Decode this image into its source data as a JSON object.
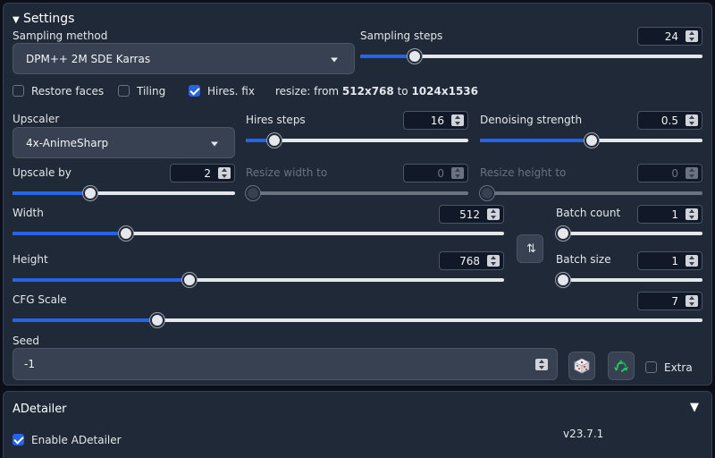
{
  "settings": {
    "title": "Settings",
    "sampling_method_label": "Sampling method",
    "sampling_method_value": "DPM++ 2M SDE Karras",
    "sampling_steps_label": "Sampling steps",
    "sampling_steps_value": "24",
    "sampling_steps_frac": 0.16,
    "restore_faces_label": "Restore faces",
    "tiling_label": "Tiling",
    "hires_fix_label": "Hires. fix",
    "resize_prefix": "resize: from ",
    "resize_from": "512x768",
    "resize_mid": " to ",
    "resize_to": "1024x1536",
    "upscaler_label": "Upscaler",
    "upscaler_value": "4x-AnimeSharp",
    "hires_steps_label": "Hires steps",
    "hires_steps_value": "16",
    "hires_steps_frac": 0.13,
    "denoising_label": "Denoising strength",
    "denoising_value": "0.5",
    "denoising_frac": 0.5,
    "upscale_by_label": "Upscale by",
    "upscale_by_value": "2",
    "upscale_by_frac": 0.35,
    "resize_width_label": "Resize width to",
    "resize_width_value": "0",
    "resize_height_label": "Resize height to",
    "resize_height_value": "0",
    "width_label": "Width",
    "width_value": "512",
    "width_frac": 0.23,
    "height_label": "Height",
    "height_value": "768",
    "height_frac": 0.36,
    "batch_count_label": "Batch count",
    "batch_count_value": "1",
    "batch_size_label": "Batch size",
    "batch_size_value": "1",
    "cfg_label": "CFG Scale",
    "cfg_value": "7",
    "cfg_frac": 0.21,
    "seed_label": "Seed",
    "seed_value": "-1",
    "extra_label": "Extra"
  },
  "adetailer": {
    "title": "ADetailer",
    "enable_label": "Enable ADetailer",
    "version": "v23.7.1"
  },
  "colors": {
    "accent": "#2563eb",
    "panel": "#1f2937",
    "bg": "#0b0f19"
  },
  "icons": {
    "swap": "swap-dimensions-icon",
    "dice": "dice-icon",
    "recycle": "recycle-icon"
  }
}
